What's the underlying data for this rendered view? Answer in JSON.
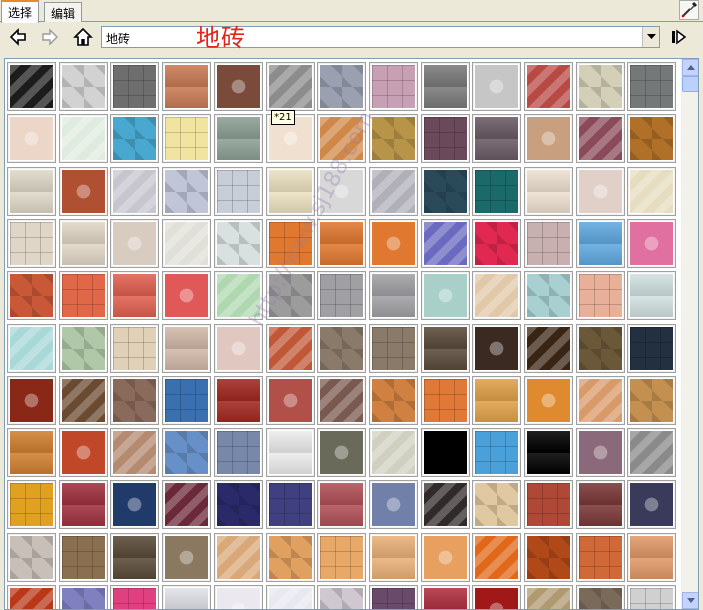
{
  "tabs": [
    {
      "label": "选择",
      "active": true
    },
    {
      "label": "编辑",
      "active": false
    }
  ],
  "toolbar": {
    "back_icon": "arrow-left-icon",
    "forward_icon": "arrow-right-icon",
    "home_icon": "home-icon",
    "location_value": "地砖",
    "details_icon": "details-arrow-icon",
    "eyedropper_icon": "eyedropper-icon"
  },
  "overlay_title": "地砖",
  "tooltip": "*21",
  "watermark": "http://www.sj188.com",
  "rows": [
    [
      "#1c1c1c",
      "#d2d2d2",
      "#6e6e6e",
      "#c87a55",
      "#7a4a3a",
      "#8c8c8c",
      "#9aa0b0",
      "#c8a0b4",
      "#7a7a7a",
      "#c6c6c6",
      "#b84a44",
      "#d4d0b8",
      "#747878"
    ],
    [
      "#ecd6c8",
      "#e0ebe0",
      "#48a8d0",
      "#f0e4a0",
      "#8ca094",
      "#f0e0d0",
      "#d08848",
      "#b89448",
      "#6a4a5a",
      "#6a5a64",
      "#c8a080",
      "#8a4a5a",
      "#b07028"
    ],
    [
      "#ded8c8",
      "#b05032",
      "#c6c6ce",
      "#c0c6d8",
      "#c8ced8",
      "#ece0c0",
      "#d8d8d8",
      "#b0b0b8",
      "#2a4a5a",
      "#1a6a6a",
      "#ede0d0",
      "#e0d0c8",
      "#e6dcc0"
    ],
    [
      "#e0d6c8",
      "#e0d6c6",
      "#d8ccc0",
      "#e0e0d8",
      "#d8e0e0",
      "#e07830",
      "#e07830",
      "#e07830",
      "#6a6ac0",
      "#e02850",
      "#c8b0b0",
      "#60a8e0",
      "#e070a0"
    ],
    [
      "#c85838",
      "#e06848",
      "#e06050",
      "#e05858",
      "#b0d8b0",
      "#9c9c9c",
      "#a0a0a4",
      "#a0a0a4",
      "#a8d0c8",
      "#e0c8a8",
      "#a8d0d0",
      "#e8b098",
      "#d0e0e0"
    ],
    [
      "#a8d8d8",
      "#b0c8a8",
      "#e0d0b8",
      "#d0b8a8",
      "#e0c8c0",
      "#c05838",
      "#8a7a6a",
      "#8a7a6a",
      "#5a4a3a",
      "#3a2a22",
      "#3a2414",
      "#6a5838",
      "#223040"
    ],
    [
      "#8a2818",
      "#6a4a30",
      "#8a6a5a",
      "#3a70b0",
      "#a02820",
      "#b05048",
      "#7a5a50",
      "#d08040",
      "#e07838",
      "#e0a048",
      "#e08a30",
      "#d89a68",
      "#c49050"
    ],
    [
      "#d08030",
      "#c04828",
      "#b48a70",
      "#6890c8",
      "#7888a8",
      "#ececec",
      "#6a6a5a",
      "#d0d0c0",
      "#000000",
      "#4aa0d8",
      "#000000",
      "#8a6a7a",
      "#8a8a8a"
    ],
    [
      "#e0a020",
      "#a03040",
      "#203a6a",
      "#6a2838",
      "#2a2a6a",
      "#404080",
      "#b05058",
      "#7080a8",
      "#302a2a",
      "#e0c8a0",
      "#b04838",
      "#7a3838",
      "#3a3a5a"
    ],
    [
      "#c8c0b8",
      "#8a7050",
      "#5a4a38",
      "#8a7860",
      "#d8a878",
      "#e0a060",
      "#e8a868",
      "#e8b078",
      "#e8a060",
      "#e06818",
      "#b04818",
      "#d06838",
      "#e09868"
    ],
    [
      "#b83818",
      "#8080c0",
      "#e04080",
      "#e0e0e8",
      "#ece8f0",
      "#e8e8f0",
      "#d0c8d0",
      "#6a4a6a",
      "#b03040",
      "#a01818",
      "#b09870",
      "#7a6a5a",
      "#d0d0d0"
    ]
  ]
}
